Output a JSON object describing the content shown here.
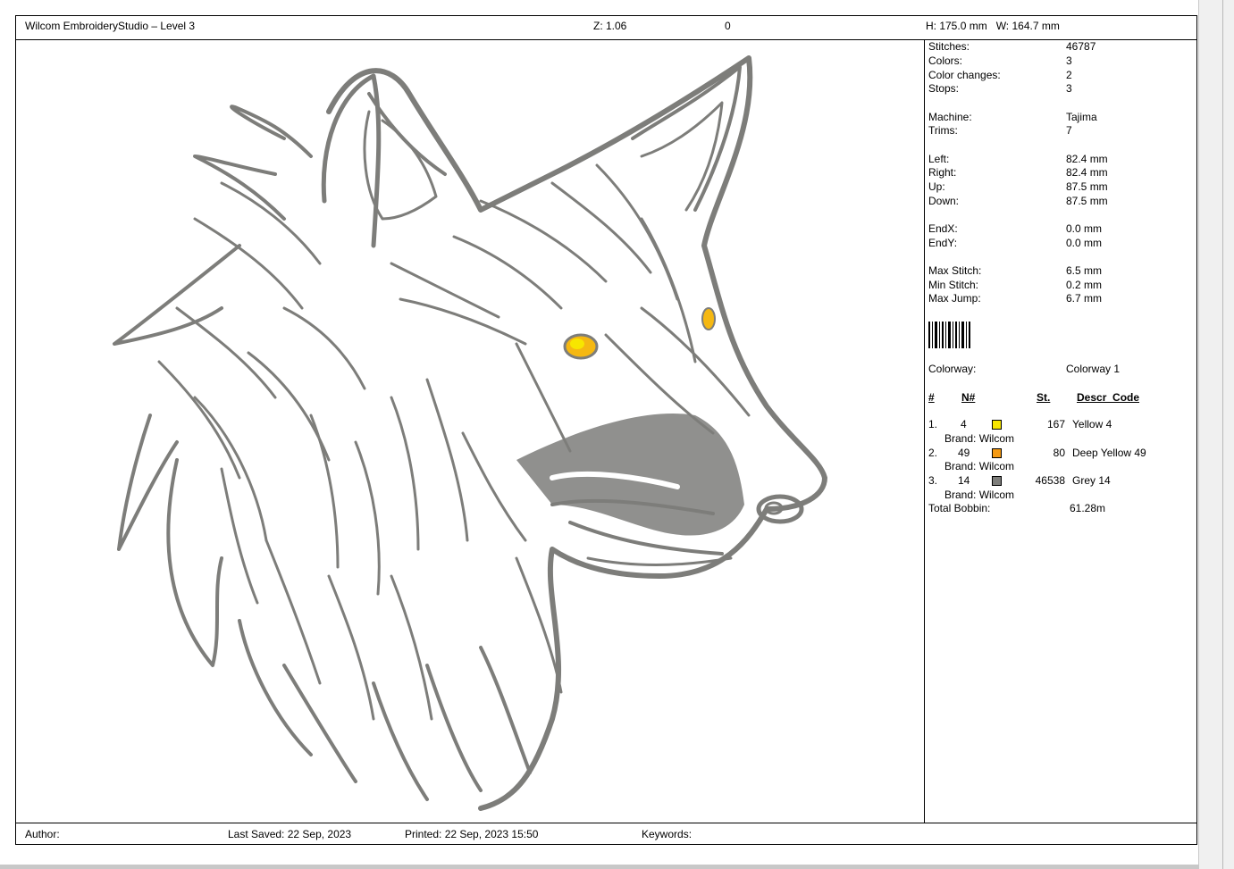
{
  "header": {
    "title": "Wilcom EmbroideryStudio – Level 3",
    "zoom": "Z: 1.06",
    "angle": "0",
    "dimensions": "H: 175.0 mm   W: 164.7 mm"
  },
  "info": {
    "stitches_label": "Stitches:",
    "stitches": "46787",
    "colors_label": "Colors:",
    "colors": "3",
    "color_changes_label": "Color changes:",
    "color_changes": "2",
    "stops_label": "Stops:",
    "stops": "3",
    "machine_label": "Machine:",
    "machine": "Tajima",
    "trims_label": "Trims:",
    "trims": "7",
    "left_label": "Left:",
    "left": "82.4 mm",
    "right_label": "Right:",
    "right": "82.4 mm",
    "up_label": "Up:",
    "up": "87.5 mm",
    "down_label": "Down:",
    "down": "87.5 mm",
    "endx_label": "EndX:",
    "endx": "0.0 mm",
    "endy_label": "EndY:",
    "endy": "0.0 mm",
    "max_stitch_label": "Max Stitch:",
    "max_stitch": "6.5 mm",
    "min_stitch_label": "Min Stitch:",
    "min_stitch": "0.2 mm",
    "max_jump_label": "Max Jump:",
    "max_jump": "6.7 mm",
    "colorway_label": "Colorway:",
    "colorway": "Colorway 1"
  },
  "color_table": {
    "headers": {
      "index": "#",
      "needle": "N#",
      "stitches": "St.",
      "descr": "Descr_Code"
    },
    "rows": [
      {
        "index": "1.",
        "needle": "4",
        "color": "#f7e600",
        "stitches": "167",
        "descr": "Yellow 4",
        "brand": "Brand: Wilcom"
      },
      {
        "index": "2.",
        "needle": "49",
        "color": "#f59a12",
        "stitches": "80",
        "descr": "Deep Yellow 49",
        "brand": "Brand: Wilcom"
      },
      {
        "index": "3.",
        "needle": "14",
        "color": "#7d7d7a",
        "stitches": "46538",
        "descr": "Grey 14",
        "brand": "Brand: Wilcom"
      }
    ],
    "total_label": "Total Bobbin:",
    "total": "61.28m"
  },
  "footer": {
    "author": "Author:",
    "last_saved": "Last Saved: 22 Sep, 2023",
    "printed": "Printed: 22 Sep, 2023 15:50",
    "keywords": "Keywords:"
  },
  "colors": {
    "thread_grey": "#7d7d7a",
    "eye_yellow": "#f7e600",
    "eye_deep_yellow": "#f5b812"
  },
  "icons": {
    "barcode": "barcode-icon"
  }
}
